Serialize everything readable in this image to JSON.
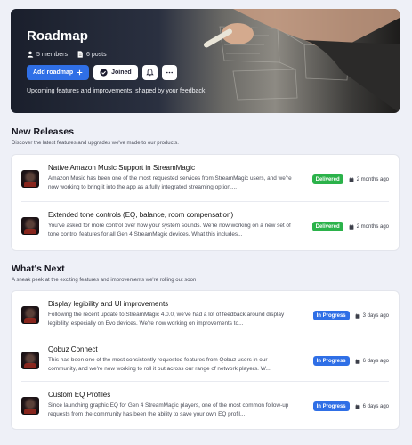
{
  "hero": {
    "title": "Roadmap",
    "members": "5 members",
    "posts": "6 posts",
    "add_label": "Add roadmap",
    "joined_label": "Joined",
    "description": "Upcoming features and improvements, shaped by your feedback."
  },
  "new_releases": {
    "title": "New Releases",
    "subtitle": "Discover the latest features and upgrades we've made to our products.",
    "items": [
      {
        "title": "Native Amazon Music Support in StreamMagic",
        "desc": "Amazon Music has been one of the most requested services from StreamMagic users, and we're now working to bring it into the app as a fully integrated streaming option....",
        "status": "Delivered",
        "time": "2 months ago"
      },
      {
        "title": "Extended tone controls (EQ, balance, room compensation)",
        "desc": "You've asked for more control over how your system sounds. We're now working on a new set of tone control features for all Gen 4 StreamMagic devices. What this includes...",
        "status": "Delivered",
        "time": "2 months ago"
      }
    ]
  },
  "whats_next": {
    "title": "What's Next",
    "subtitle": "A sneak peek at the exciting features and improvements we're rolling out soon",
    "items": [
      {
        "title": "Display legibility and UI improvements",
        "desc": "Following the recent update to StreamMagic 4.0.0, we've had a lot of feedback around display legibility, especially on Evo devices. We're now working on improvements to...",
        "status": "In Progress",
        "time": "3 days ago"
      },
      {
        "title": "Qobuz Connect",
        "desc": "This has been one of the most consistently requested features from Qobuz users in our community, and we're now working to roll it out across our range of network players. W...",
        "status": "In Progress",
        "time": "6 days ago"
      },
      {
        "title": "Custom EQ Profiles",
        "desc": "Since launching graphic EQ for Gen 4 StreamMagic players, one of the most common follow-up requests from the community has been the ability to save your own EQ profil...",
        "status": "In Progress",
        "time": "6 days ago"
      }
    ]
  },
  "colors": {
    "accent": "#2f6fe6",
    "delivered": "#2bb24a",
    "background": "#eef0f7"
  },
  "icons": {
    "members": "users-icon",
    "posts": "document-icon",
    "add": "plus-icon",
    "joined": "check-circle-icon",
    "bell": "bell-plus-icon",
    "more": "more-horizontal-icon",
    "time": "calendar-icon"
  }
}
